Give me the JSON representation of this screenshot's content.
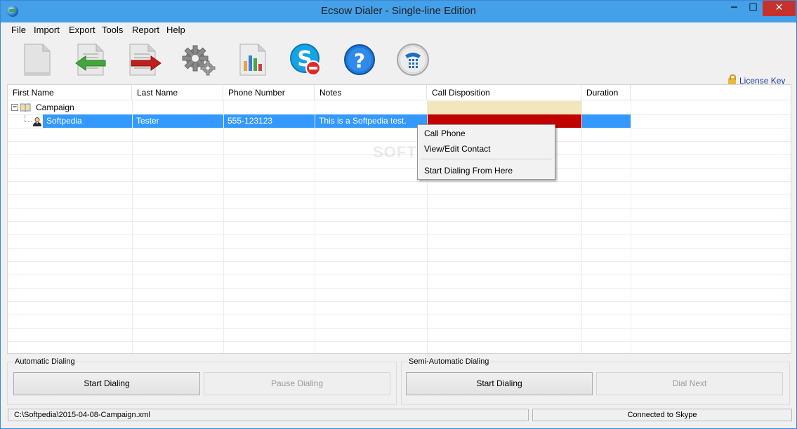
{
  "window": {
    "title": "Ecsow Dialer - Single-line Edition",
    "min": "─",
    "max": "☐",
    "close": "✕"
  },
  "menu": [
    "File",
    "Import",
    "Export",
    "Tools",
    "Report",
    "Help"
  ],
  "toolbar": {
    "icons": [
      "new-file-icon",
      "import-icon",
      "export-icon",
      "settings-icon",
      "report-chart-icon",
      "skype-disconnect-icon",
      "help-icon",
      "phone-dialpad-icon"
    ],
    "license_key": "License Key"
  },
  "grid": {
    "columns": [
      "First Name",
      "Last Name",
      "Phone Number",
      "Notes",
      "Call Disposition",
      "Duration"
    ],
    "group": {
      "toggle": "−",
      "label": "Campaign"
    },
    "rows": [
      {
        "first_name": "Softpedia",
        "last_name": "Tester",
        "phone": "555-123123",
        "notes": "This is a Softpedia test.",
        "disposition": "",
        "duration": ""
      }
    ],
    "colors": {
      "campaign_disposition": "#f2e6bd",
      "row_disposition": "#c10000",
      "selection": "#3399ff"
    }
  },
  "context_menu": [
    "Call Phone",
    "View/Edit Contact",
    "Start Dialing From Here"
  ],
  "watermark": "SOFTPEDIA",
  "automatic": {
    "label": "Automatic Dialing",
    "start": "Start Dialing",
    "pause": "Pause Dialing"
  },
  "semi_automatic": {
    "label": "Semi-Automatic Dialing",
    "start": "Start Dialing",
    "next": "Dial Next"
  },
  "status": {
    "file": "C:\\Softpedia\\2015-04-08-Campaign.xml",
    "connection": "Connected to Skype"
  }
}
